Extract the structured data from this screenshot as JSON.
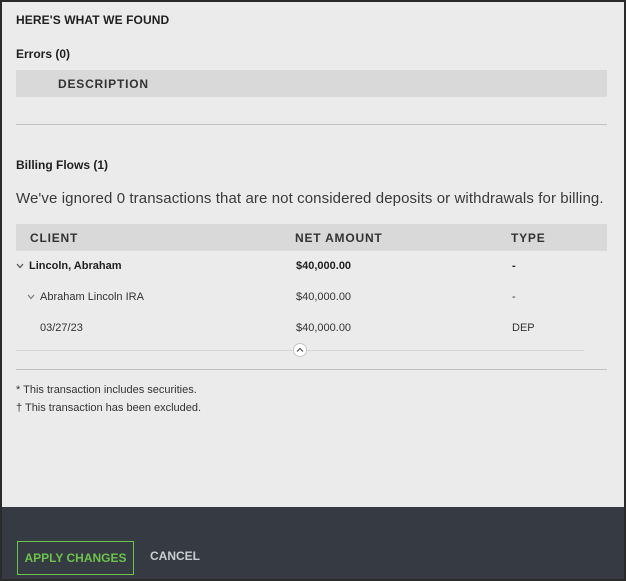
{
  "heading": "HERE'S WHAT WE FOUND",
  "errors": {
    "title": "Errors (0)",
    "columns": [
      "DESCRIPTION"
    ]
  },
  "billing_flows": {
    "title": "Billing Flows (1)",
    "info": "We've ignored 0 transactions that are not considered deposits or withdrawals for billing.",
    "columns": {
      "client": "CLIENT",
      "net_amount": "NET AMOUNT",
      "type": "TYPE"
    },
    "rows": [
      {
        "client": "Lincoln, Abraham",
        "net_amount": "$40,000.00",
        "type": "-"
      },
      {
        "client": "Abraham Lincoln IRA",
        "net_amount": "$40,000.00",
        "type": "-"
      },
      {
        "client": "03/27/23",
        "net_amount": "$40,000.00",
        "type": "DEP"
      }
    ]
  },
  "footnotes": [
    "* This transaction includes securities.",
    "† This transaction has been excluded."
  ],
  "footer": {
    "apply_label": "APPLY CHANGES",
    "cancel_label": "CANCEL"
  },
  "colors": {
    "accent": "#6cc24a",
    "footer_bg": "#353a43",
    "panel_bg": "#ebebeb",
    "table_header_bg": "#d9d9d9"
  }
}
